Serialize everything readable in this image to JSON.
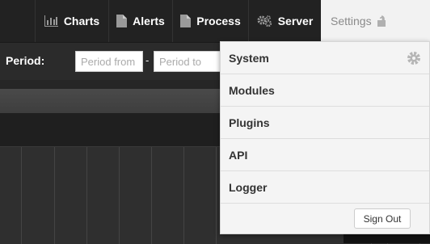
{
  "nav": {
    "items": [
      {
        "label": "Charts",
        "icon": "bar-chart-icon"
      },
      {
        "label": "Alerts",
        "icon": "document-icon"
      },
      {
        "label": "Process",
        "icon": "document-icon"
      },
      {
        "label": "Server",
        "icon": "gears-icon"
      },
      {
        "label": "Settings",
        "icon": "unlock-icon",
        "active": true
      }
    ]
  },
  "filter": {
    "period_label": "Period:",
    "from_placeholder": "Period from",
    "to_placeholder": "Period to",
    "separator": "-"
  },
  "settings_menu": {
    "items": [
      {
        "label": "System",
        "icon": "gear-icon"
      },
      {
        "label": "Modules"
      },
      {
        "label": "Plugins"
      },
      {
        "label": "API"
      },
      {
        "label": "Logger"
      }
    ],
    "sign_out_label": "Sign Out"
  },
  "colors": {
    "nav_bg": "#222222",
    "active_tab_bg": "#f2f2f2",
    "menu_bg": "#f4f4f4",
    "page_bg": "#262626"
  }
}
